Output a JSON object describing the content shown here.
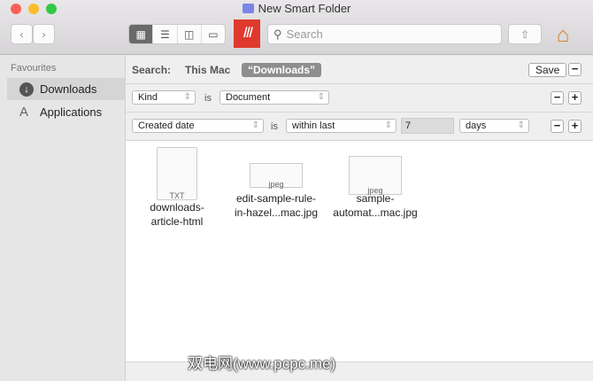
{
  "window": {
    "title": "New Smart Folder"
  },
  "toolbar": {
    "search_placeholder": "Search",
    "view_modes": [
      "icon",
      "list",
      "column",
      "gallery"
    ]
  },
  "sidebar": {
    "heading": "Favourites",
    "items": [
      {
        "label": "Downloads",
        "icon": "download-icon",
        "selected": true
      },
      {
        "label": "Applications",
        "icon": "applications-icon",
        "selected": false
      }
    ]
  },
  "searchbar": {
    "label": "Search:",
    "scope_this_mac": "This Mac",
    "scope_selected": "“Downloads”",
    "save": "Save"
  },
  "rules": [
    {
      "attribute": "Kind",
      "operator": "is",
      "value": "Document"
    },
    {
      "attribute": "Created date",
      "operator": "is",
      "value": "within last",
      "amount": "7",
      "unit": "days"
    }
  ],
  "files": [
    {
      "name_line1": "downloads-",
      "name_line2": "article-html",
      "badge": "TXT"
    },
    {
      "name_line1": "edit-sample-rule-",
      "name_line2": "in-hazel...mac.jpg",
      "badge": "jpeg"
    },
    {
      "name_line1": "sample-",
      "name_line2": "automat...mac.jpg",
      "badge": "jpeg"
    }
  ],
  "watermark": "双电网(www.pcpc.me)"
}
